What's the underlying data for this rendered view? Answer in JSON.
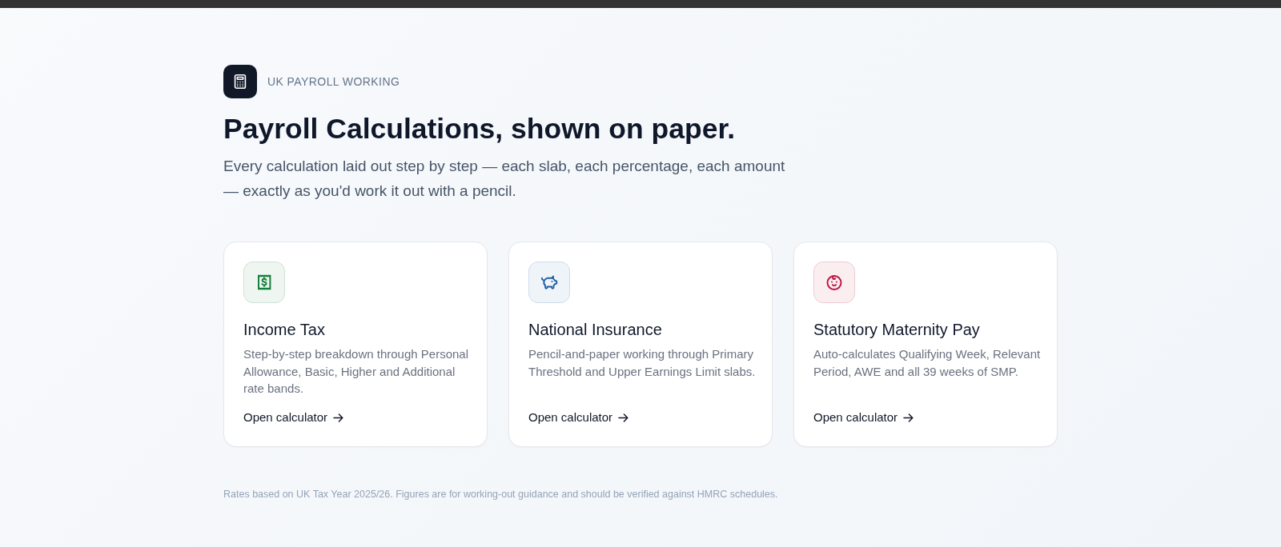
{
  "brand": {
    "label": "UK PAYROLL WORKING"
  },
  "hero": {
    "title": "Payroll Calculations, shown on paper.",
    "subtitle": "Every calculation laid out step by step — each slab, each percentage, each amount — exactly as you'd work it out with a pencil."
  },
  "cards": [
    {
      "kind": "receipt",
      "color": "#15803d",
      "title": "Income Tax",
      "description": "Step-by-step breakdown through Personal Allowance, Basic, Higher and Additional rate bands.",
      "link": "Open calculator"
    },
    {
      "kind": "piggybank",
      "color": "#1e5fa8",
      "title": "National Insurance",
      "description": "Pencil-and-paper working through Primary Threshold and Upper Earnings Limit slabs.",
      "link": "Open calculator"
    },
    {
      "kind": "baby",
      "color": "#be123c",
      "title": "Statutory Maternity Pay",
      "description": "Auto-calculates Qualifying Week, Relevant Period, AWE and all 39 weeks of SMP.",
      "link": "Open calculator"
    }
  ],
  "footer": {
    "note": "Rates based on UK Tax Year 2025/26. Figures are for working-out guidance and should be verified against HMRC schedules."
  }
}
